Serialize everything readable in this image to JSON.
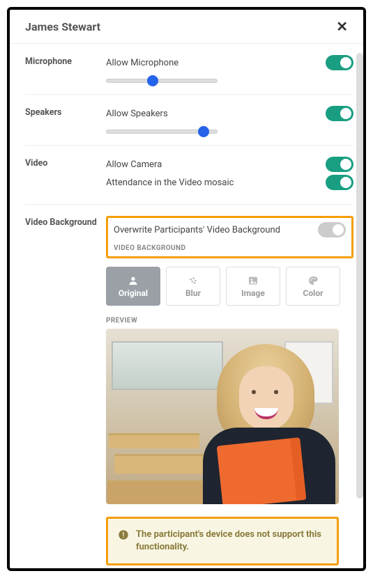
{
  "header": {
    "title": "James Stewart"
  },
  "microphone": {
    "label": "Microphone",
    "allow_label": "Allow Microphone",
    "allow_on": true,
    "slider_percent": 42
  },
  "speakers": {
    "label": "Speakers",
    "allow_label": "Allow Speakers",
    "allow_on": true,
    "slider_percent": 88
  },
  "video": {
    "label": "Video",
    "allow_camera_label": "Allow Camera",
    "allow_camera_on": true,
    "mosaic_label": "Attendance in the Video mosaic",
    "mosaic_on": true
  },
  "video_background": {
    "label": "Video Background",
    "overwrite_label": "Overwrite Participants' Video Background",
    "overwrite_on": false,
    "section_caption": "VIDEO BACKGROUND",
    "options": {
      "original": "Original",
      "blur": "Blur",
      "image": "Image",
      "color": "Color"
    },
    "selected": "original",
    "preview_caption": "PREVIEW"
  },
  "warning": {
    "text": "The participant's device does not support this functionality."
  }
}
